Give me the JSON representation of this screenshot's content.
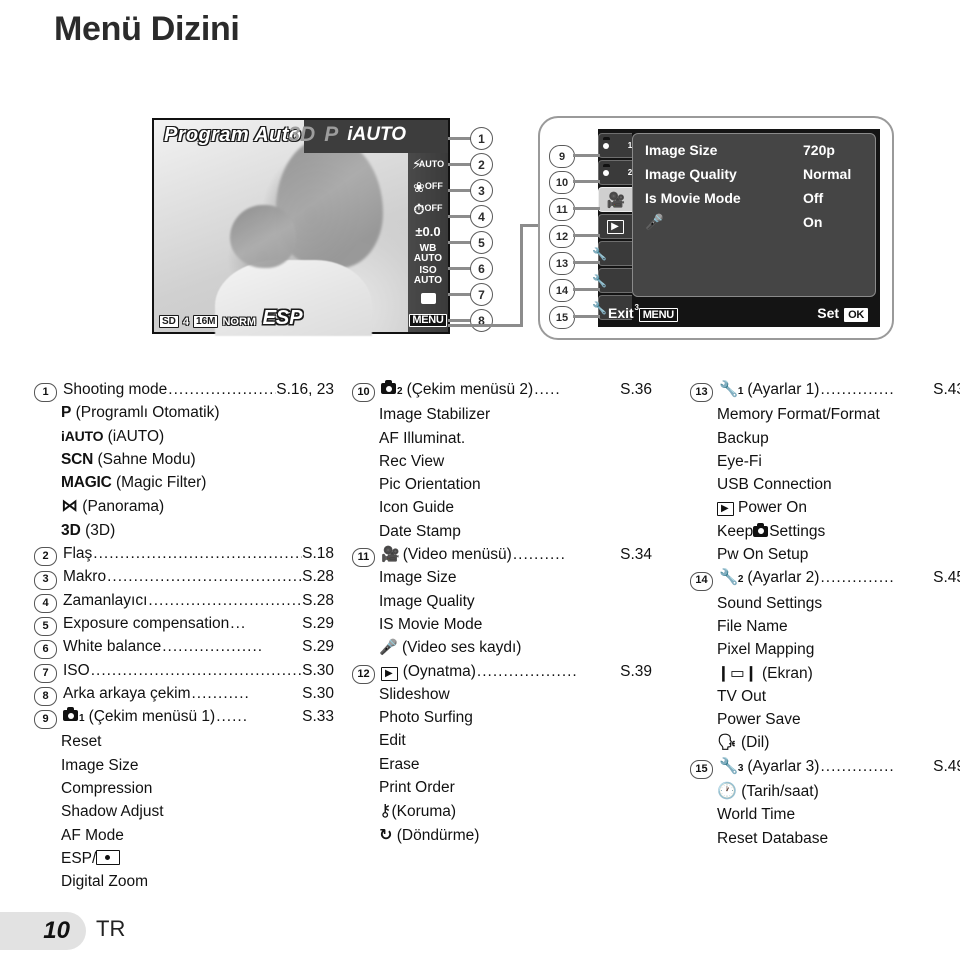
{
  "page": {
    "title": "Menü Dizini",
    "number": "10",
    "lang_code": "TR"
  },
  "lcd": {
    "mode_name": "Program Auto",
    "top_modes": [
      "3D",
      "P",
      "iAUTO"
    ],
    "right_strip": [
      {
        "icon": "flash-icon",
        "label": "AUTO"
      },
      {
        "icon": "macro-flower-icon",
        "label": "OFF"
      },
      {
        "icon": "self-timer-icon",
        "label": "OFF"
      },
      {
        "icon": "exposure-compensation-icon",
        "label": "±0.0"
      },
      {
        "icon": "white-balance-icon",
        "label": "WB AUTO"
      },
      {
        "icon": "iso-icon",
        "label": "ISO AUTO"
      },
      {
        "icon": "drive-mode-icon",
        "label": ""
      },
      {
        "icon": "menu-icon",
        "label": "MENU"
      }
    ],
    "bottom_left": [
      "SD",
      "4",
      "16M",
      "NORM"
    ],
    "metering": "ESP"
  },
  "callouts_left": [
    "1",
    "2",
    "3",
    "4",
    "5",
    "6",
    "7",
    "8"
  ],
  "callouts_right": [
    "9",
    "10",
    "11",
    "12",
    "13",
    "14",
    "15"
  ],
  "menu_screen": {
    "tabs": [
      {
        "icon": "camera1-tab-icon",
        "label": "1",
        "active": false
      },
      {
        "icon": "camera2-tab-icon",
        "label": "2",
        "active": false
      },
      {
        "icon": "video-tab-icon",
        "label": "",
        "active": true
      },
      {
        "icon": "playback-tab-icon",
        "label": "",
        "active": false
      },
      {
        "icon": "settings1-tab-icon",
        "label": "1",
        "active": false
      },
      {
        "icon": "settings2-tab-icon",
        "label": "2",
        "active": false
      },
      {
        "icon": "settings3-tab-icon",
        "label": "3",
        "active": false
      }
    ],
    "rows": [
      {
        "label": "Image Size",
        "value": "720p"
      },
      {
        "label": "Image Quality",
        "value": "Normal"
      },
      {
        "label": "Is Movie Mode",
        "value": "Off"
      },
      {
        "label": "",
        "icon": "microphone-icon",
        "value": "On"
      }
    ],
    "footer_exit": "Exit",
    "footer_exit_key": "MENU",
    "footer_set": "Set",
    "footer_set_key": "OK"
  },
  "index": {
    "column1": [
      {
        "num": "1",
        "text": "Shooting mode",
        "page": "S.16, 23",
        "dots": true
      },
      {
        "sub": "P (Programlı Otomatik)"
      },
      {
        "sub": "iAUTO (iAUTO)"
      },
      {
        "sub": "SCN (Sahne Modu)"
      },
      {
        "sub": "MAGIC (Magic Filter)"
      },
      {
        "sub": "⋈ (Panorama)"
      },
      {
        "sub": "3D (3D)"
      },
      {
        "num": "2",
        "text": "Flaş",
        "page": "S.18",
        "dots": true
      },
      {
        "num": "3",
        "text": "Makro",
        "page": "S.28",
        "dots": true
      },
      {
        "num": "4",
        "text": "Zamanlayıcı",
        "page": "S.28",
        "dots": true
      },
      {
        "num": "5",
        "text": "Exposure compensation",
        "page": "S.29",
        "dots": true
      },
      {
        "num": "6",
        "text": "White balance",
        "page": "S.29",
        "dots": true
      },
      {
        "num": "7",
        "text": "ISO",
        "page": "S.30",
        "dots": true
      },
      {
        "num": "8",
        "text": "Arka arkaya çekim",
        "page": "S.30",
        "dots": true
      },
      {
        "num": "9",
        "text": "(Çekim menüsü 1)",
        "icon": "camera1-icon",
        "page": "S.33",
        "dots": true
      },
      {
        "sub": "Reset"
      },
      {
        "sub": "Image Size"
      },
      {
        "sub": "Compression"
      },
      {
        "sub": "Shadow Adjust"
      },
      {
        "sub": "AF Mode"
      },
      {
        "sub": "ESP/spot"
      },
      {
        "sub": "Digital Zoom"
      }
    ],
    "column2": [
      {
        "num": "10",
        "text": "(Çekim menüsü 2)",
        "icon": "camera2-icon",
        "page": "S.36",
        "dots": true
      },
      {
        "sub": "Image Stabilizer"
      },
      {
        "sub": "AF Illuminat."
      },
      {
        "sub": "Rec View"
      },
      {
        "sub": "Pic Orientation"
      },
      {
        "sub": "Icon Guide"
      },
      {
        "sub": "Date Stamp"
      },
      {
        "num": "11",
        "text": "(Video menüsü)",
        "icon": "video-icon",
        "page": "S.34",
        "dots": true
      },
      {
        "sub": "Image Size"
      },
      {
        "sub": "Image Quality"
      },
      {
        "sub": "IS Movie Mode"
      },
      {
        "sub": "(Video ses kaydı)"
      },
      {
        "num": "12",
        "text": "(Oynatma)",
        "icon": "playback-icon",
        "page": "S.39",
        "dots": true
      },
      {
        "sub": "Slideshow"
      },
      {
        "sub": "Photo Surfing"
      },
      {
        "sub": "Edit"
      },
      {
        "sub": "Erase"
      },
      {
        "sub": "Print Order"
      },
      {
        "sub": "(Koruma)"
      },
      {
        "sub": "(Döndürme)"
      }
    ],
    "column3": [
      {
        "num": "13",
        "text": "(Ayarlar 1)",
        "icon": "settings1-icon",
        "page": "S.43",
        "dots": true
      },
      {
        "sub": "Memory Format/Format"
      },
      {
        "sub": "Backup"
      },
      {
        "sub": "Eye-Fi"
      },
      {
        "sub": "USB Connection"
      },
      {
        "sub": "Power On"
      },
      {
        "sub": "KeepSettings"
      },
      {
        "sub": "Pw On Setup"
      },
      {
        "num": "14",
        "text": "(Ayarlar 2)",
        "icon": "settings2-icon",
        "page": "S.45",
        "dots": true
      },
      {
        "sub": "Sound Settings"
      },
      {
        "sub": "File Name"
      },
      {
        "sub": "Pixel Mapping"
      },
      {
        "sub": "(Ekran)"
      },
      {
        "sub": "TV Out"
      },
      {
        "sub": "Power Save"
      },
      {
        "sub": "(Dil)"
      },
      {
        "num": "15",
        "text": "(Ayarlar 3)",
        "icon": "settings3-icon",
        "page": "S.49",
        "dots": true
      },
      {
        "sub": "(Tarih/saat)"
      },
      {
        "sub": "World Time"
      },
      {
        "sub": "Reset Database"
      }
    ]
  },
  "colors": {
    "page_bg": "#ffffff",
    "text": "#111111",
    "lead_line": "#8c8c8c",
    "panel_border": "#9a9a9a",
    "menu_bg": "#141414",
    "menu_list_bg": "#454545",
    "footer_pill": "#e2e2e2"
  }
}
